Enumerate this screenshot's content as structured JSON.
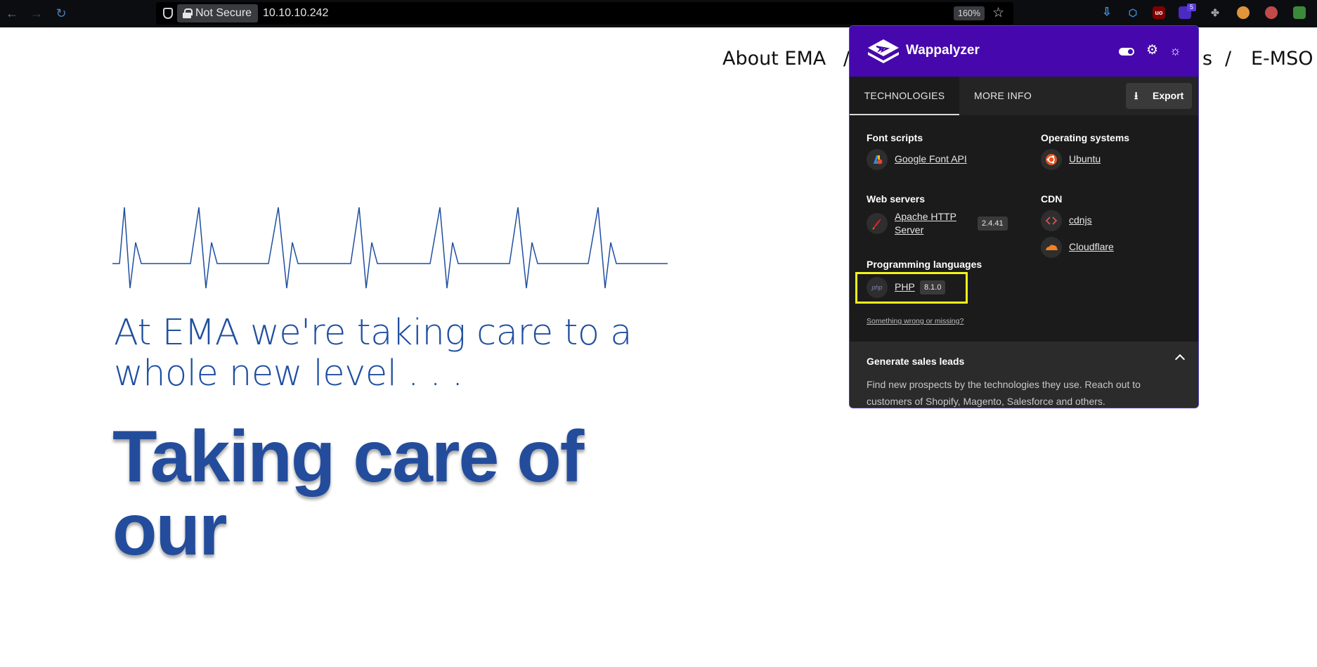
{
  "browser": {
    "not_secure_label": "Not Secure",
    "url": "10.10.10.242",
    "zoom": "160%",
    "extension_badge": "5",
    "ublock_label": "uo"
  },
  "site": {
    "nav_items": [
      "About EMA",
      "/",
      "s",
      "/",
      "E-MSO"
    ],
    "tagline": "At EMA we're taking care to a whole new level . . .",
    "hero": "Taking care of our",
    "colors": {
      "brand_blue": "#1f4fa0"
    }
  },
  "wappalyzer": {
    "title": "Wappalyzer",
    "tabs": [
      "TECHNOLOGIES",
      "MORE INFO"
    ],
    "export_label": "Export",
    "categories": {
      "font_scripts": {
        "label": "Font scripts",
        "items": [
          {
            "name": "Google Font API"
          }
        ]
      },
      "operating_systems": {
        "label": "Operating systems",
        "items": [
          {
            "name": "Ubuntu"
          }
        ]
      },
      "web_servers": {
        "label": "Web servers",
        "items": [
          {
            "name": "Apache HTTP Server",
            "line1": "Apache HTTP",
            "line2": "Server",
            "version": "2.4.41"
          }
        ]
      },
      "cdn": {
        "label": "CDN",
        "items": [
          {
            "name": "cdnjs"
          },
          {
            "name": "Cloudflare"
          }
        ]
      },
      "programming_languages": {
        "label": "Programming languages",
        "items": [
          {
            "name": "PHP",
            "version": "8.1.0",
            "icon_text": "php"
          }
        ]
      }
    },
    "missing_link": "Something wrong or missing?",
    "leads": {
      "title": "Generate sales leads",
      "text": "Find new prospects by the technologies they use. Reach out to customers of Shopify, Magento, Salesforce and others."
    },
    "colors": {
      "header": "#4608ad",
      "panel": "#1b1b1b",
      "highlight": "#f3f31a"
    }
  }
}
